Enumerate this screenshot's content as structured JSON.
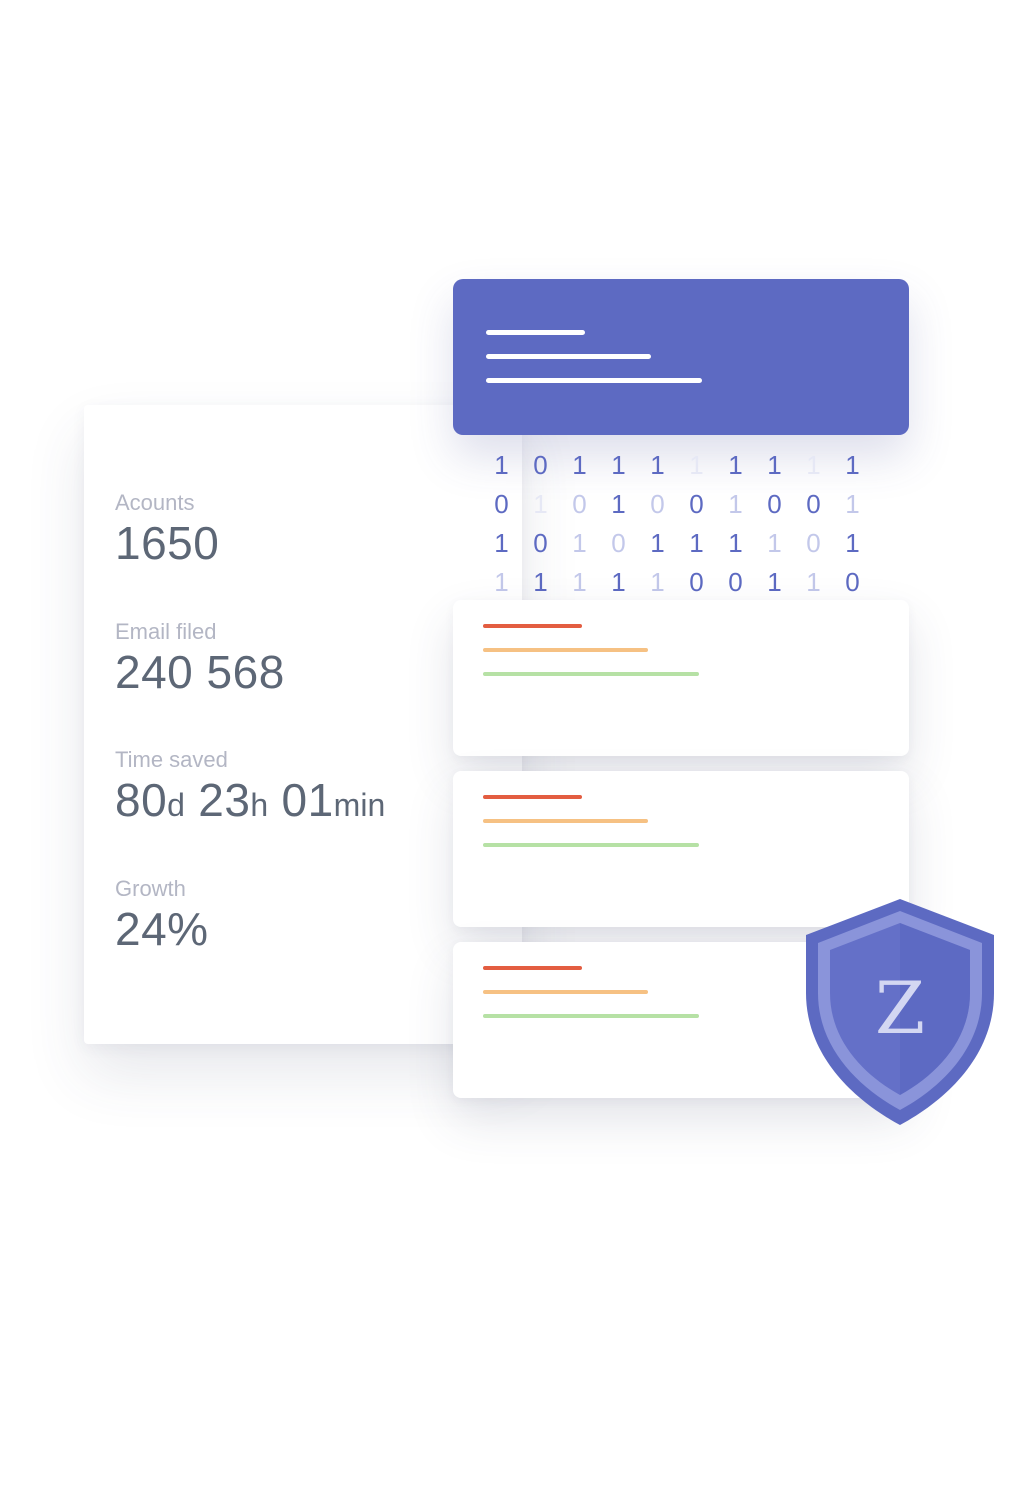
{
  "stats": {
    "accounts": {
      "label": "Acounts",
      "value": "1650"
    },
    "email": {
      "label": "Email filed",
      "value": "240 568"
    },
    "time": {
      "label": "Time saved",
      "days": "80",
      "days_unit": "d",
      "hours": "23",
      "hours_unit": "h",
      "minutes": "01",
      "minutes_unit": "min"
    },
    "growth": {
      "label": "Growth",
      "value": "24%"
    }
  },
  "binary": {
    "rows": [
      [
        "1",
        "0",
        "1",
        "1",
        "1",
        "1",
        "1",
        "1",
        "1",
        "1"
      ],
      [
        "0",
        "1",
        "0",
        "1",
        "0",
        "0",
        "1",
        "0",
        "0",
        "1"
      ],
      [
        "1",
        "0",
        "1",
        "0",
        "1",
        "1",
        "1",
        "1",
        "0",
        "1"
      ],
      [
        "1",
        "1",
        "1",
        "1",
        "1",
        "0",
        "0",
        "1",
        "1",
        "0"
      ]
    ],
    "intensity": [
      [
        "s",
        "s",
        "s",
        "s",
        "s",
        "v",
        "s",
        "s",
        "v",
        "s"
      ],
      [
        "s",
        "v",
        "f",
        "s",
        "f",
        "s",
        "f",
        "s",
        "s",
        "f"
      ],
      [
        "s",
        "s",
        "f",
        "f",
        "s",
        "s",
        "s",
        "f",
        "f",
        "s"
      ],
      [
        "f",
        "s",
        "f",
        "s",
        "f",
        "s",
        "s",
        "s",
        "f",
        "s"
      ]
    ]
  },
  "shield": {
    "letter": "Z"
  },
  "colors": {
    "accent": "#5d6ac2",
    "red": "#e35d41",
    "orange": "#f6c183",
    "green": "#b6e1a5",
    "value_text": "#5d6776",
    "label_text": "#b3b6c4"
  }
}
